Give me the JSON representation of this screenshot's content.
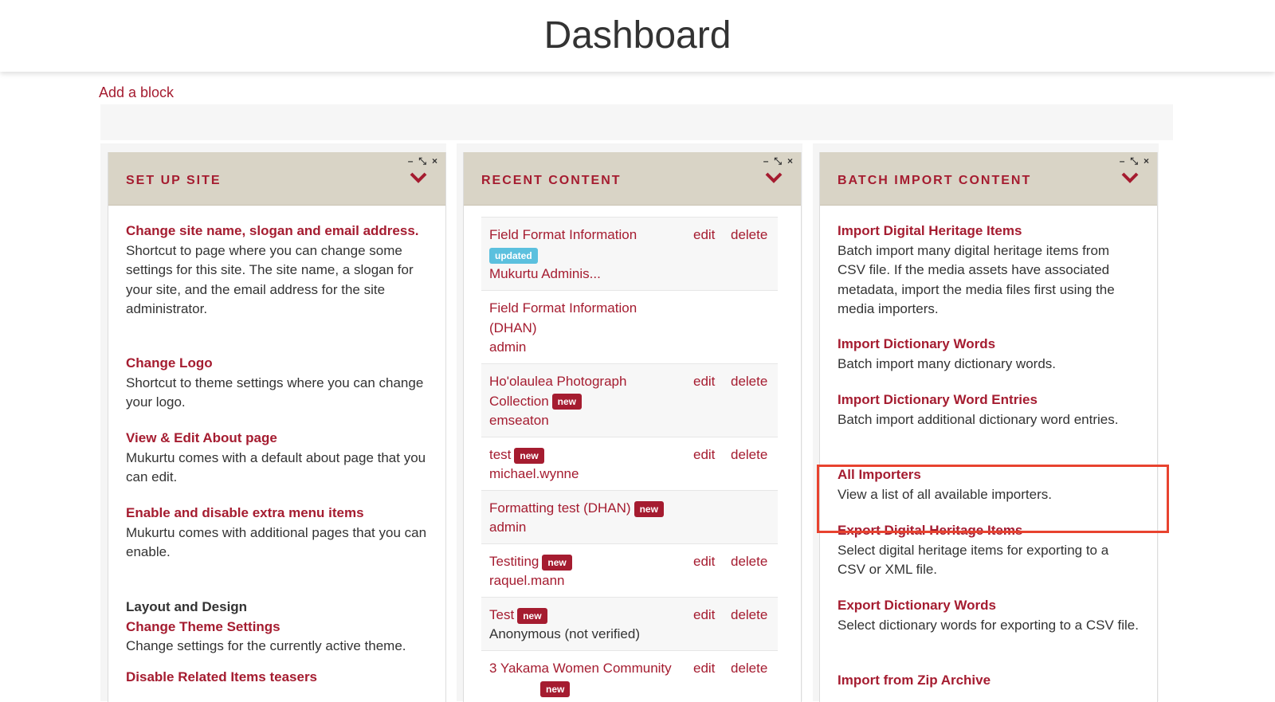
{
  "page": {
    "title": "Dashboard",
    "add_block": "Add a block"
  },
  "panel_controls": {
    "minimize": "–",
    "expand": "⤡",
    "close": "×"
  },
  "setup": {
    "title": "Set up site",
    "items": [
      {
        "link": "Change site name, slogan and email address.",
        "desc": "Shortcut to page where you can change some settings for this site. The site name, a slogan for your site, and the email address for the site administrator."
      },
      {
        "link": "Change Logo",
        "desc": "Shortcut to theme settings where you can change your logo."
      },
      {
        "link": "View & Edit About page",
        "desc": "Mukurtu comes with a default about page that you can edit."
      },
      {
        "link": "Enable and disable extra menu items",
        "desc": "Mukurtu comes with additional pages that you can enable."
      }
    ],
    "layout_heading": "Layout and Design",
    "theme_link": "Change Theme Settings",
    "theme_desc": "Change settings for the currently active theme.",
    "related_link": "Disable Related Items teasers"
  },
  "recent": {
    "title": "Recent content",
    "edit_label": "edit",
    "delete_label": "delete",
    "rows": [
      {
        "title": "Field Format Information",
        "badge": "updated",
        "user": "Mukurtu Adminis..."
      },
      {
        "title": "Field Format Information (DHAN)",
        "badge": "",
        "user": "admin"
      },
      {
        "title": "Ho'olaulea Photograph Collection",
        "badge": "new",
        "user": "emseaton"
      },
      {
        "title": "test",
        "badge": "new",
        "user": "michael.wynne"
      },
      {
        "title": "Formatting test (DHAN)",
        "badge": "new",
        "user": "admin"
      },
      {
        "title": "Testiting",
        "badge": "new",
        "user": "raquel.mann"
      },
      {
        "title": "Test",
        "badge": "new",
        "user": "Anonymous (not verified)"
      },
      {
        "title": "3 Yakama Women Community",
        "badge": "new",
        "user": ""
      }
    ]
  },
  "batch": {
    "title": "Batch import content",
    "items": [
      {
        "link": "Import Digital Heritage Items",
        "desc": "Batch import many digital heritage items from CSV file. If the media assets have associated metadata, import the media files first using the media importers."
      },
      {
        "link": "Import Dictionary Words",
        "desc": "Batch import many dictionary words."
      },
      {
        "link": "Import Dictionary Word Entries",
        "desc": "Batch import additional dictionary word entries."
      },
      {
        "link": "All Importers",
        "desc": "View a list of all available importers."
      },
      {
        "link": "Export Digital Heritage Items",
        "desc": "Select digital heritage items for exporting to a CSV or XML file."
      },
      {
        "link": "Export Dictionary Words",
        "desc": "Select dictionary words for exporting to a CSV file."
      },
      {
        "link": "Import from Zip Archive",
        "desc": ""
      }
    ]
  },
  "colors": {
    "accent": "#a51c30",
    "header_bg": "#d9d4c6",
    "badge_updated": "#5bc0de",
    "highlight": "#e8432f"
  }
}
